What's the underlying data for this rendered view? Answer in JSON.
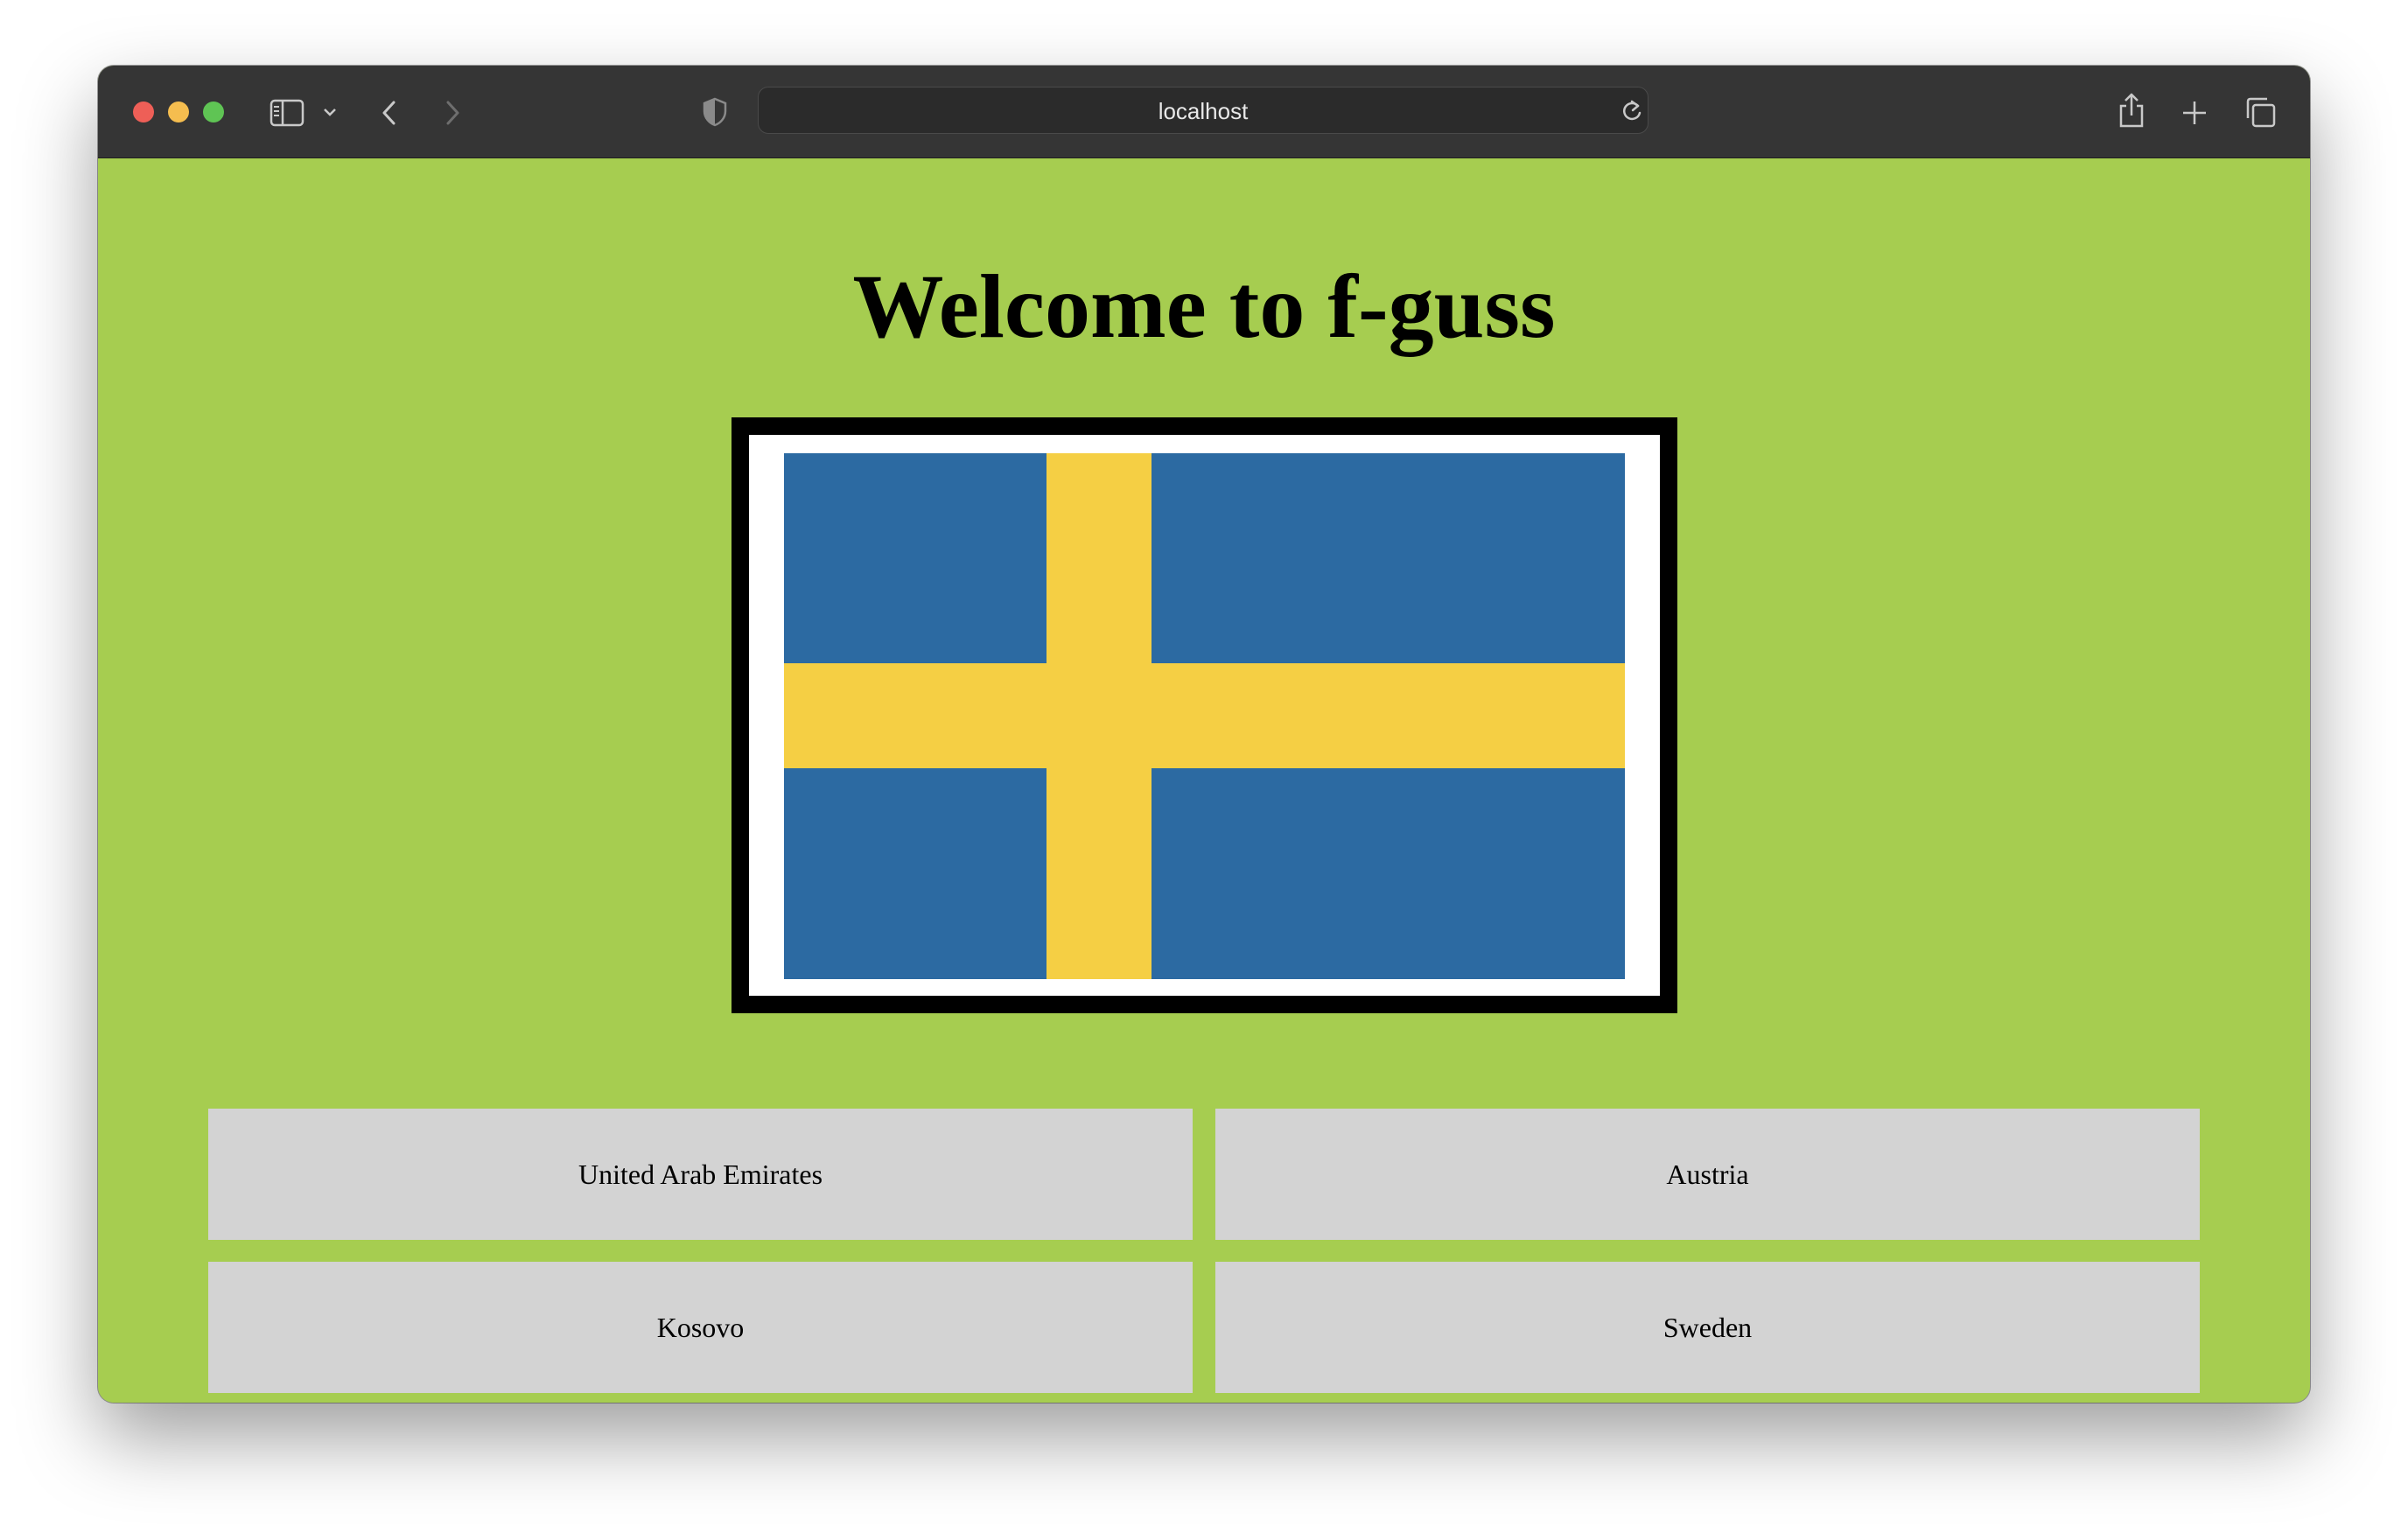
{
  "browser": {
    "url": "localhost",
    "icons": {
      "sidebar": "sidebar-icon",
      "chevron": "chevron-down-icon",
      "back": "back-arrow-icon",
      "forward": "forward-arrow-icon",
      "privacy": "shield-icon",
      "reload": "reload-icon",
      "share": "share-icon",
      "new_tab": "plus-icon",
      "tabs": "tabs-overview-icon"
    }
  },
  "page": {
    "title": "Welcome to f-guss",
    "background_color": "#a6cd50",
    "flag": {
      "name": "sweden-flag-image",
      "colors": {
        "blue": "#2c6aa2",
        "yellow": "#f5cf44"
      }
    },
    "answers": [
      {
        "label": "United Arab Emirates"
      },
      {
        "label": "Austria"
      },
      {
        "label": "Kosovo"
      },
      {
        "label": "Sweden"
      }
    ],
    "answer_button_color": "#d3d3d3"
  }
}
